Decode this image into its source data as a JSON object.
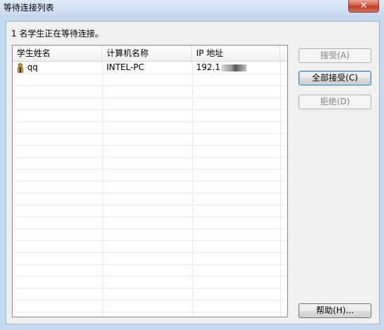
{
  "window": {
    "title": "等待连接列表",
    "close_glyph": "✕"
  },
  "status_text": "1 名学生正在等待连接。",
  "list": {
    "columns": [
      "学生姓名",
      "计算机名称",
      "IP 地址"
    ],
    "rows": [
      {
        "name": "qq",
        "computer": "INTEL-PC",
        "ip": "192.1"
      }
    ]
  },
  "buttons": {
    "accept": "接受(A)",
    "accept_all": "全部接受(C)",
    "reject": "拒绝(D)",
    "help": "帮助(H)..."
  },
  "icons": {
    "student": "user-icon"
  }
}
